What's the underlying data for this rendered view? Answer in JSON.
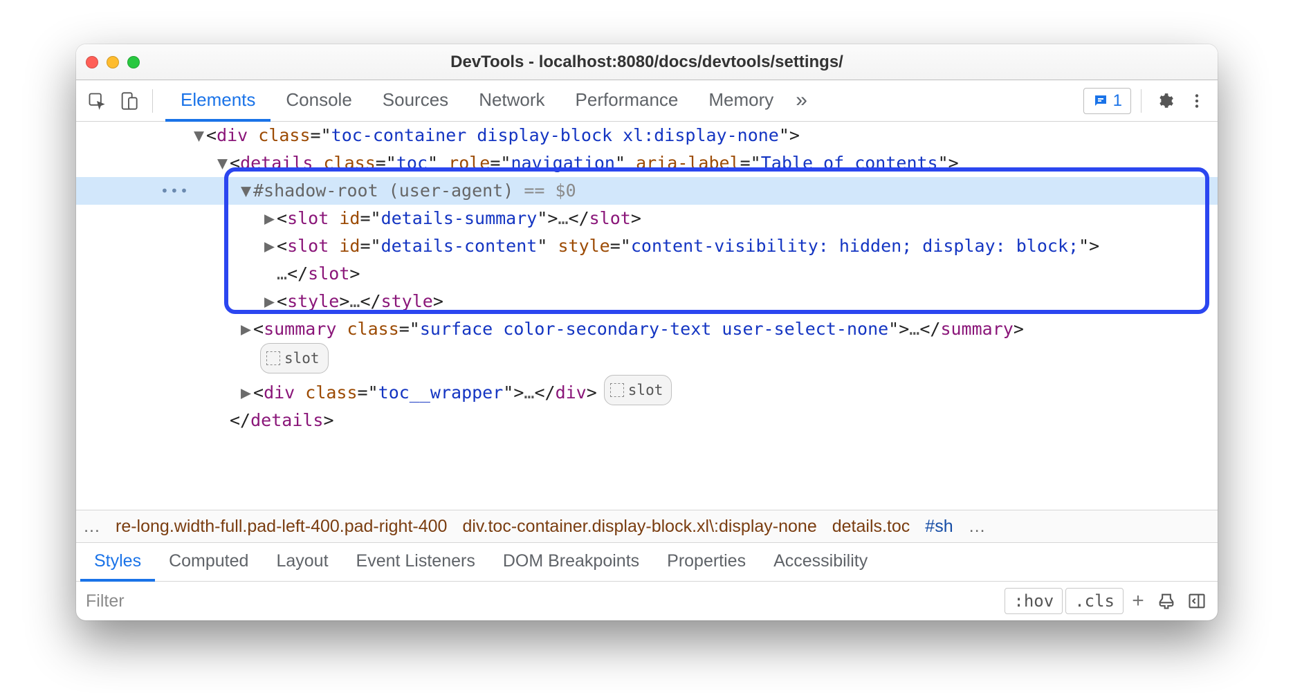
{
  "window": {
    "title": "DevTools - localhost:8080/docs/devtools/settings/"
  },
  "mainTabs": {
    "items": [
      "Elements",
      "Console",
      "Sources",
      "Network",
      "Performance",
      "Memory"
    ],
    "activeIndex": 0,
    "moreGlyph": "»",
    "issuesCount": "1"
  },
  "dom": {
    "gutterEllipsis": "•••",
    "eqVar": "== $0",
    "lines": {
      "l1": {
        "tag": "div",
        "attrName": "class",
        "attrVal": "toc-container display-block xl:display-none"
      },
      "l2": {
        "tag": "details",
        "a1n": "class",
        "a1v": "toc",
        "a2n": "role",
        "a2v": "navigation",
        "a3n": "aria-label",
        "a3v": "Table of contents"
      },
      "l3": {
        "text": "#shadow-root (user-agent)"
      },
      "l4": {
        "tag": "slot",
        "an": "id",
        "av": "details-summary",
        "mid": "…"
      },
      "l5": {
        "tag": "slot",
        "a1n": "id",
        "a1v": "details-content",
        "a2n": "style",
        "a2v": "content-visibility: hidden; display: block;"
      },
      "l6": {
        "mid": "…",
        "close": "slot"
      },
      "l7": {
        "tag": "style",
        "mid": "…"
      },
      "l8": {
        "tag": "summary",
        "an": "class",
        "av": "surface color-secondary-text user-select-none",
        "mid": "…"
      },
      "l9": {
        "badge": "slot"
      },
      "l10": {
        "tag": "div",
        "an": "class",
        "av": "toc__wrapper",
        "mid": "…",
        "badge": "slot"
      },
      "l11": {
        "close": "details"
      }
    }
  },
  "breadcrumb": {
    "leading": "…",
    "items": [
      "re-long.width-full.pad-left-400.pad-right-400",
      "div.toc-container.display-block.xl\\:display-none",
      "details.toc",
      "#sh"
    ],
    "trailing": "…"
  },
  "lowerTabs": {
    "items": [
      "Styles",
      "Computed",
      "Layout",
      "Event Listeners",
      "DOM Breakpoints",
      "Properties",
      "Accessibility"
    ],
    "activeIndex": 0
  },
  "stylesBar": {
    "filterPlaceholder": "Filter",
    "hov": ":hov",
    "cls": ".cls"
  }
}
